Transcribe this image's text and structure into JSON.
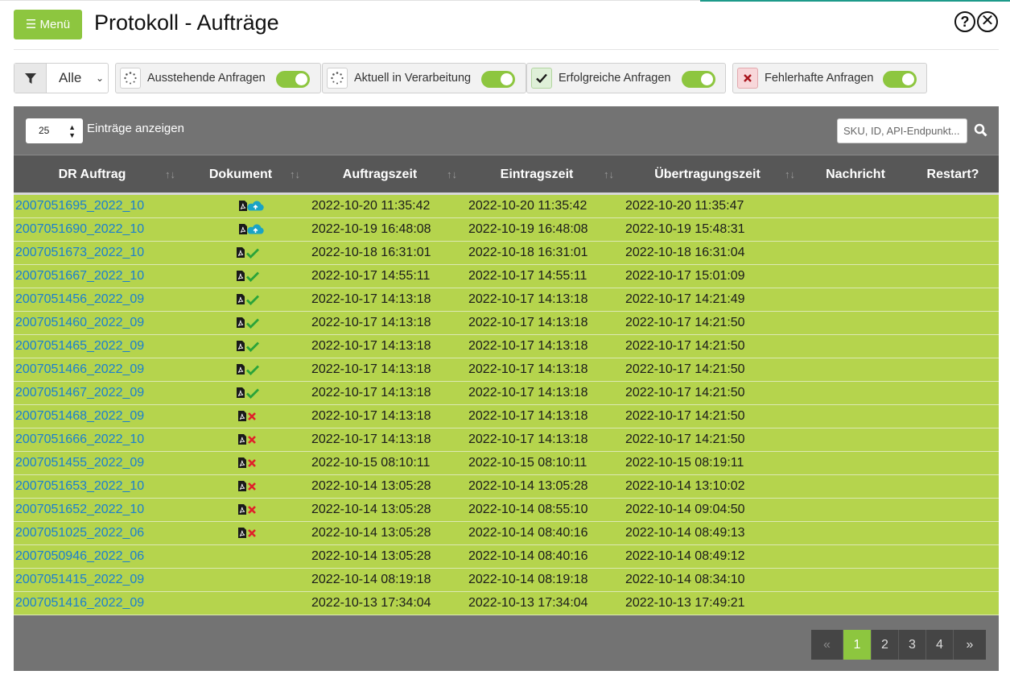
{
  "header": {
    "menu_label": "☰ Menü",
    "title": "Protokoll - Aufträge",
    "help_glyph": "?",
    "close_glyph": "✕"
  },
  "filters": {
    "status_select": "Alle",
    "toggles": [
      {
        "label": "Ausstehende Anfragen",
        "icon": "spinner-icon",
        "on": true
      },
      {
        "label": "Aktuell in Verarbeitung",
        "icon": "spinner-icon",
        "on": true
      },
      {
        "label": "Erfolgreiche Anfragen",
        "icon": "check-icon",
        "on": true
      },
      {
        "label": "Fehlerhafte Anfragen",
        "icon": "x-icon",
        "on": true
      }
    ]
  },
  "table_controls": {
    "page_length": "25",
    "page_length_label": "Einträge anzeigen",
    "search_placeholder": "SKU, ID, API-Endpunkt..."
  },
  "columns": [
    "DR Auftrag",
    "Dokument",
    "Auftragszeit",
    "Eintragszeit",
    "Übertragungszeit",
    "Nachricht",
    "Restart?"
  ],
  "rows": [
    {
      "auftrag": "2007051695_2022_10",
      "doc": "upload",
      "auftragszeit": "2022-10-20 11:35:42",
      "eintragszeit": "2022-10-20 11:35:42",
      "uebertragungszeit": "2022-10-20 11:35:47"
    },
    {
      "auftrag": "2007051690_2022_10",
      "doc": "upload",
      "auftragszeit": "2022-10-19 16:48:08",
      "eintragszeit": "2022-10-19 16:48:08",
      "uebertragungszeit": "2022-10-19 15:48:31"
    },
    {
      "auftrag": "2007051673_2022_10",
      "doc": "success",
      "auftragszeit": "2022-10-18 16:31:01",
      "eintragszeit": "2022-10-18 16:31:01",
      "uebertragungszeit": "2022-10-18 16:31:04"
    },
    {
      "auftrag": "2007051667_2022_10",
      "doc": "success",
      "auftragszeit": "2022-10-17 14:55:11",
      "eintragszeit": "2022-10-17 14:55:11",
      "uebertragungszeit": "2022-10-17 15:01:09"
    },
    {
      "auftrag": "2007051456_2022_09",
      "doc": "success",
      "auftragszeit": "2022-10-17 14:13:18",
      "eintragszeit": "2022-10-17 14:13:18",
      "uebertragungszeit": "2022-10-17 14:21:49"
    },
    {
      "auftrag": "2007051460_2022_09",
      "doc": "success",
      "auftragszeit": "2022-10-17 14:13:18",
      "eintragszeit": "2022-10-17 14:13:18",
      "uebertragungszeit": "2022-10-17 14:21:50"
    },
    {
      "auftrag": "2007051465_2022_09",
      "doc": "success",
      "auftragszeit": "2022-10-17 14:13:18",
      "eintragszeit": "2022-10-17 14:13:18",
      "uebertragungszeit": "2022-10-17 14:21:50"
    },
    {
      "auftrag": "2007051466_2022_09",
      "doc": "success",
      "auftragszeit": "2022-10-17 14:13:18",
      "eintragszeit": "2022-10-17 14:13:18",
      "uebertragungszeit": "2022-10-17 14:21:50"
    },
    {
      "auftrag": "2007051467_2022_09",
      "doc": "success",
      "auftragszeit": "2022-10-17 14:13:18",
      "eintragszeit": "2022-10-17 14:13:18",
      "uebertragungszeit": "2022-10-17 14:21:50"
    },
    {
      "auftrag": "2007051468_2022_09",
      "doc": "error",
      "auftragszeit": "2022-10-17 14:13:18",
      "eintragszeit": "2022-10-17 14:13:18",
      "uebertragungszeit": "2022-10-17 14:21:50"
    },
    {
      "auftrag": "2007051666_2022_10",
      "doc": "error",
      "auftragszeit": "2022-10-17 14:13:18",
      "eintragszeit": "2022-10-17 14:13:18",
      "uebertragungszeit": "2022-10-17 14:21:50"
    },
    {
      "auftrag": "2007051455_2022_09",
      "doc": "error",
      "auftragszeit": "2022-10-15 08:10:11",
      "eintragszeit": "2022-10-15 08:10:11",
      "uebertragungszeit": "2022-10-15 08:19:11"
    },
    {
      "auftrag": "2007051653_2022_10",
      "doc": "error",
      "auftragszeit": "2022-10-14 13:05:28",
      "eintragszeit": "2022-10-14 13:05:28",
      "uebertragungszeit": "2022-10-14 13:10:02"
    },
    {
      "auftrag": "2007051652_2022_10",
      "doc": "error",
      "auftragszeit": "2022-10-14 13:05:28",
      "eintragszeit": "2022-10-14 08:55:10",
      "uebertragungszeit": "2022-10-14 09:04:50"
    },
    {
      "auftrag": "2007051025_2022_06",
      "doc": "error",
      "auftragszeit": "2022-10-14 13:05:28",
      "eintragszeit": "2022-10-14 08:40:16",
      "uebertragungszeit": "2022-10-14 08:49:13"
    },
    {
      "auftrag": "2007050946_2022_06",
      "doc": "",
      "auftragszeit": "2022-10-14 13:05:28",
      "eintragszeit": "2022-10-14 08:40:16",
      "uebertragungszeit": "2022-10-14 08:49:12"
    },
    {
      "auftrag": "2007051415_2022_09",
      "doc": "",
      "auftragszeit": "2022-10-14 08:19:18",
      "eintragszeit": "2022-10-14 08:19:18",
      "uebertragungszeit": "2022-10-14 08:34:10"
    },
    {
      "auftrag": "2007051416_2022_09",
      "doc": "",
      "auftragszeit": "2022-10-13 17:34:04",
      "eintragszeit": "2022-10-13 17:34:04",
      "uebertragungszeit": "2022-10-13 17:49:21"
    }
  ],
  "pagination": {
    "prev_glyph": "«",
    "pages": [
      "1",
      "2",
      "3",
      "4"
    ],
    "current": "1",
    "next_glyph": "»"
  },
  "colors": {
    "accent": "#8dc63f",
    "row_bg": "#b5d44d",
    "link": "#1a7fd0",
    "panel": "#737373",
    "header": "#575757"
  }
}
